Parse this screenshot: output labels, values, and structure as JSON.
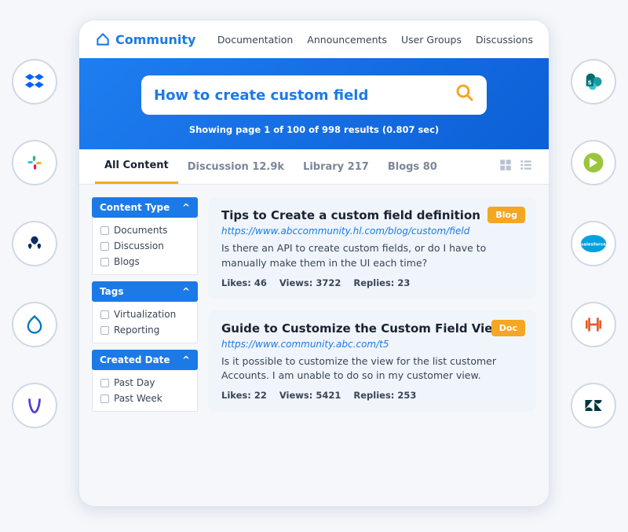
{
  "brand": "Community",
  "nav": [
    "Documentation",
    "Announcements",
    "User Groups",
    "Discussions"
  ],
  "search": {
    "value": "How to create custom field",
    "info": "Showing page 1 of 100 of 998 results (0.807 sec)"
  },
  "tabs": [
    {
      "label": "All Content",
      "active": true
    },
    {
      "label": "Discussion 12.9k"
    },
    {
      "label": "Library 217"
    },
    {
      "label": "Blogs 80"
    }
  ],
  "filters": {
    "content_type": {
      "label": "Content Type",
      "opts": [
        "Documents",
        "Discussion",
        "Blogs"
      ]
    },
    "tags": {
      "label": "Tags",
      "opts": [
        "Virtualization",
        "Reporting"
      ]
    },
    "created_date": {
      "label": "Created Date",
      "opts": [
        "Past Day",
        "Past Week"
      ]
    }
  },
  "results": [
    {
      "title": "Tips to Create a custom field definition",
      "badge": "Blog",
      "url": "https://www.abccommunity.hl.com/blog/custom/field",
      "snippet": "Is there an API to create custom fields, or do I have to manually make them in the UI each time?",
      "likes": "Likes: 46",
      "views": "Views: 3722",
      "replies": "Replies: 23"
    },
    {
      "title": "Guide to Customize the Custom Field View",
      "badge": "Doc",
      "url": "https://www.community.abc.com/t5",
      "snippet": "Is it possible to customize the view for the list customer Accounts. I am unable to do so in my customer view.",
      "likes": "Likes: 22",
      "views": "Views: 5421",
      "replies": "Replies: 253"
    }
  ],
  "left_icons": [
    "dropbox",
    "slack",
    "atlassian",
    "drupal",
    "amplitude"
  ],
  "right_icons": [
    "sharepoint",
    "pendo",
    "salesforce",
    "hashicorp",
    "zendesk"
  ]
}
